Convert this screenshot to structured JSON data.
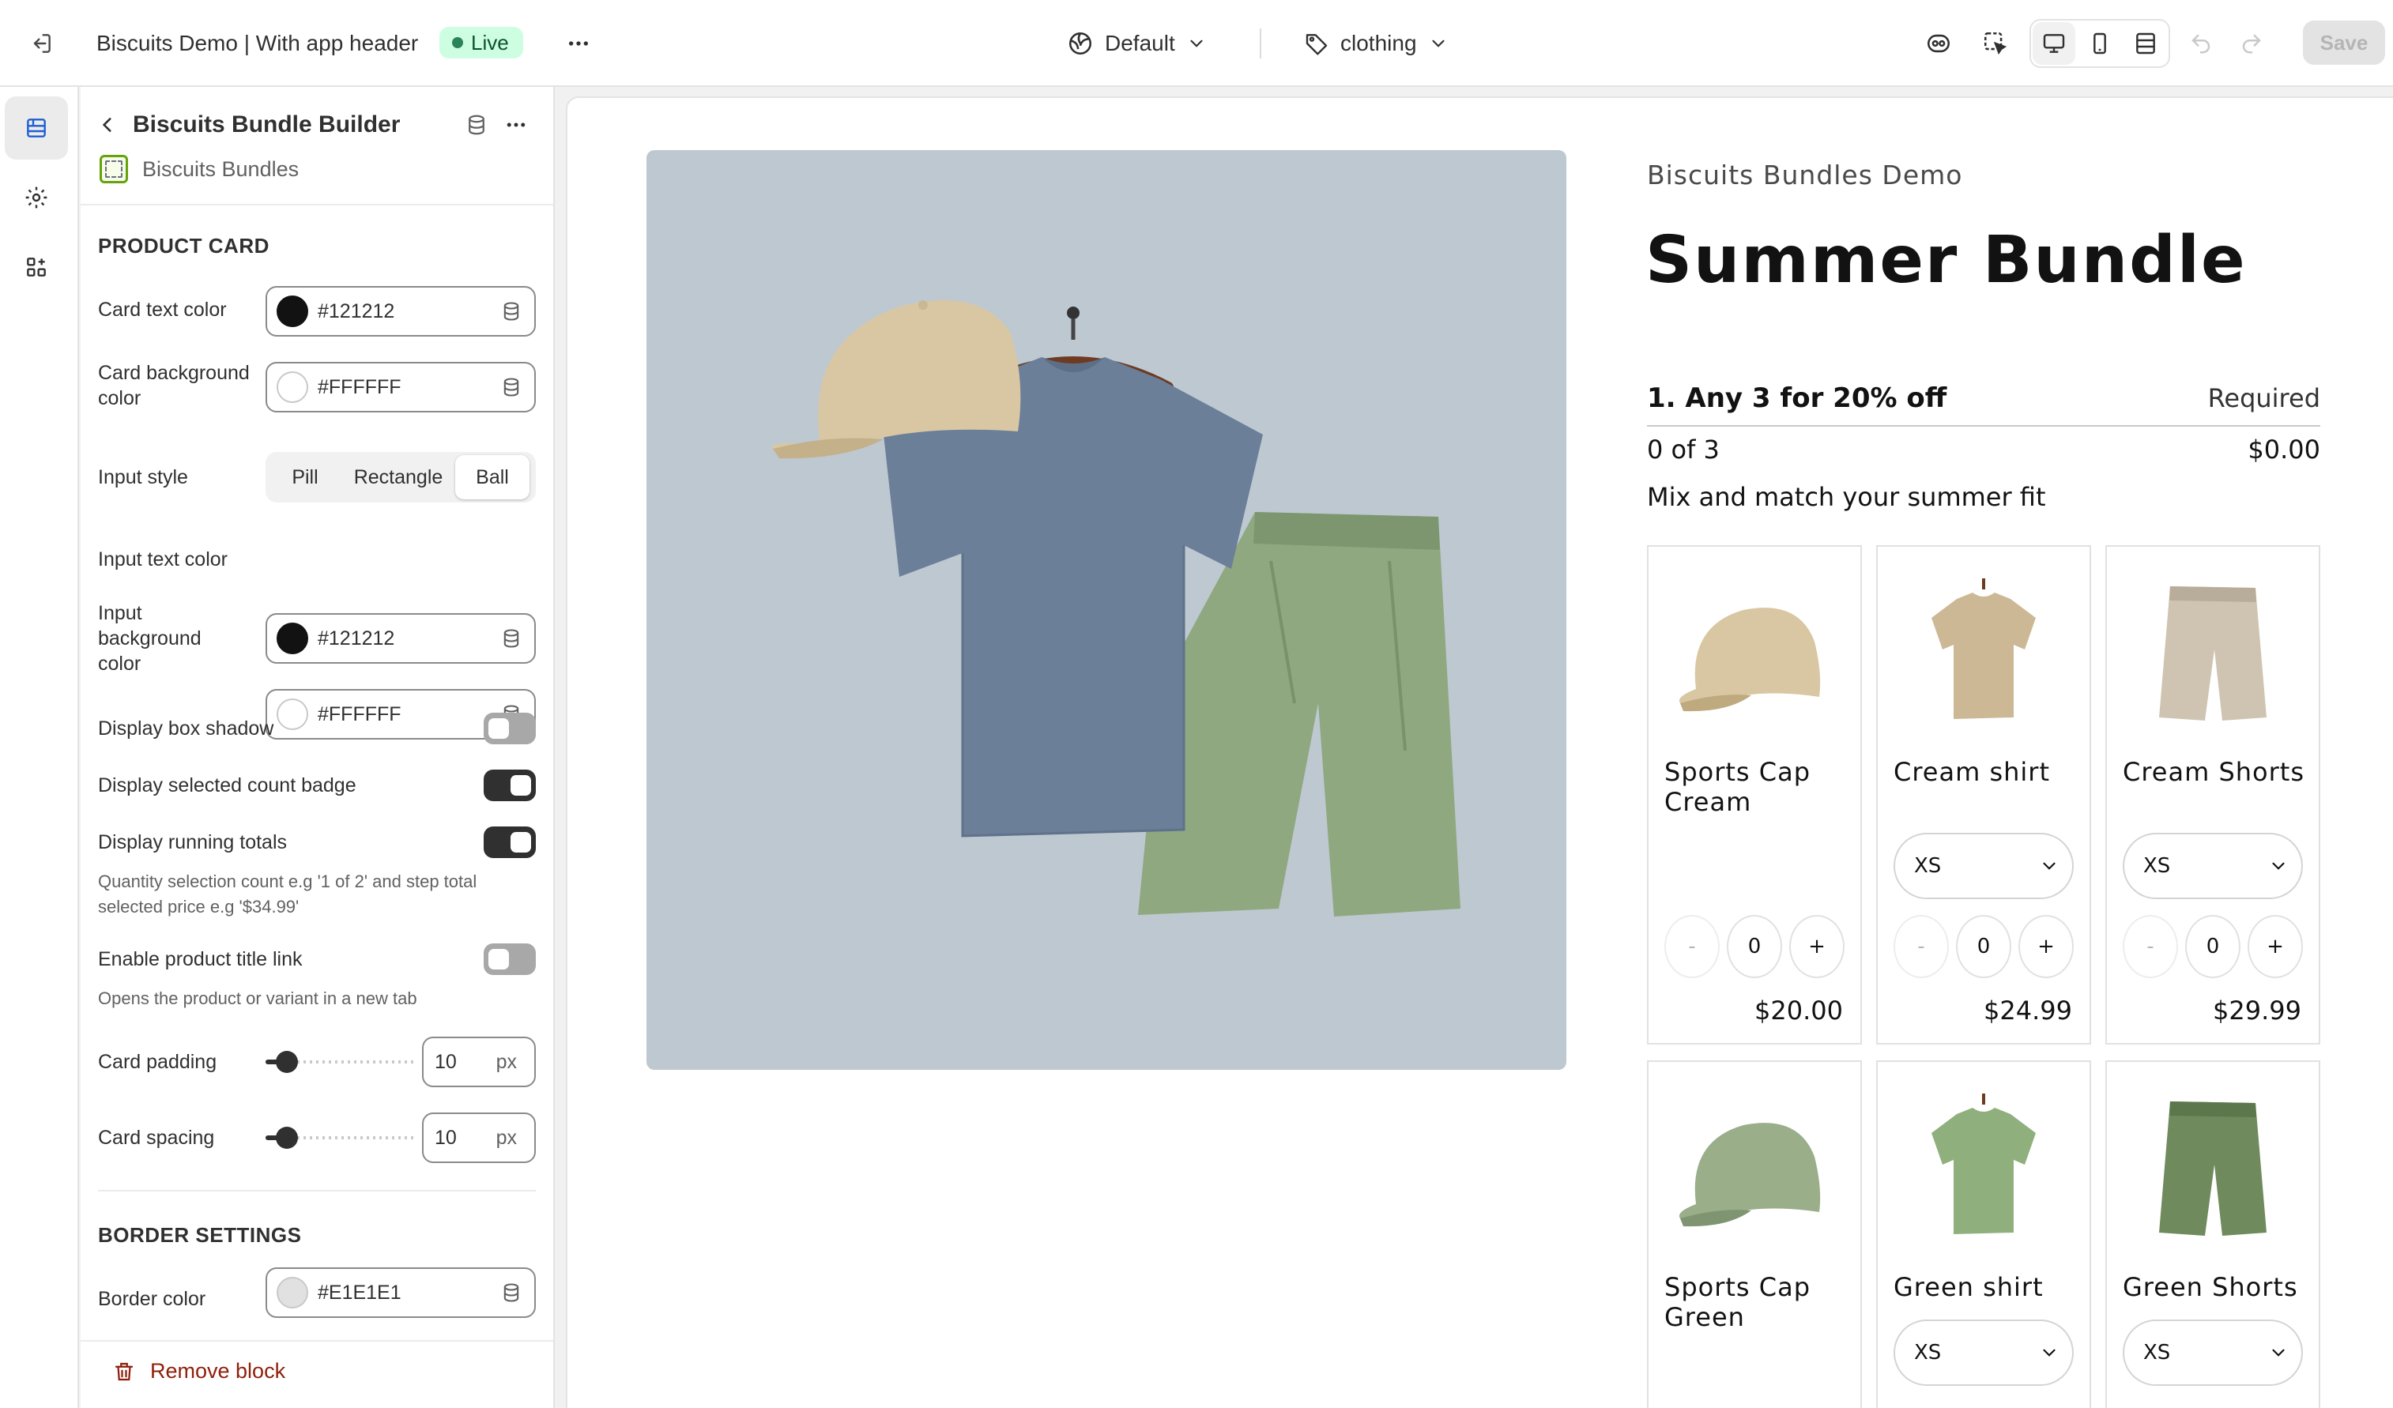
{
  "topbar": {
    "app_title": "Biscuits Demo | With app header",
    "status": "Live",
    "theme": "Default",
    "template": "clothing",
    "save_label": "Save",
    "colors": {
      "live_bg": "#cdfee1",
      "live_text": "#0c5132"
    }
  },
  "panel": {
    "title": "Biscuits Bundle Builder",
    "subtitle": "Biscuits Bundles",
    "product_card": {
      "section_title": "PRODUCT CARD",
      "card_text_color": {
        "label": "Card text color",
        "value": "#121212"
      },
      "card_bg_color": {
        "label": "Card background color",
        "value": "#FFFFFF"
      },
      "input_style": {
        "label": "Input style",
        "options": [
          "Pill",
          "Rectangle",
          "Ball"
        ],
        "selected": "Ball"
      },
      "input_text_color": {
        "label": "Input text color",
        "value": "#121212"
      },
      "input_bg_color": {
        "label": "Input background color",
        "value": "#FFFFFF"
      },
      "box_shadow": {
        "label": "Display box shadow",
        "on": false
      },
      "count_badge": {
        "label": "Display selected count badge",
        "on": true
      },
      "running_totals": {
        "label": "Display running totals",
        "on": true,
        "help": "Quantity selection count e.g '1 of 2' and step total selected price e.g '$34.99'"
      },
      "title_link": {
        "label": "Enable product title link",
        "on": false,
        "help": "Opens the product or variant in a new tab"
      },
      "card_padding": {
        "label": "Card padding",
        "value": "10",
        "unit": "px",
        "fraction": 0.08
      },
      "card_spacing": {
        "label": "Card spacing",
        "value": "10",
        "unit": "px",
        "fraction": 0.08
      }
    },
    "border_settings": {
      "section_title": "BORDER SETTINGS",
      "border_color": {
        "label": "Border color",
        "value": "#E1E1E1"
      }
    },
    "remove_label": "Remove block"
  },
  "preview": {
    "vendor": "Biscuits Bundles Demo",
    "product_title": "Summer Bundle",
    "step": {
      "title": "1.  Any 3 for 20% off",
      "required": "Required",
      "count": "0  of  3",
      "total": "$0.00",
      "description": "Mix and match your summer fit"
    },
    "cards": [
      {
        "name": "Sports Cap Cream",
        "price": "$20.00",
        "qty": "0",
        "image": "cap-cream"
      },
      {
        "name": "Cream shirt",
        "price": "$24.99",
        "qty": "0",
        "variant": "XS",
        "image": "shirt-cream"
      },
      {
        "name": "Cream Shorts",
        "price": "$29.99",
        "qty": "0",
        "variant": "XS",
        "image": "shorts-cream"
      },
      {
        "name": "Sports Cap Green",
        "image": "cap-green"
      },
      {
        "name": "Green shirt",
        "variant": "XS",
        "image": "shirt-green"
      },
      {
        "name": "Green Shorts",
        "variant": "XS",
        "image": "shorts-green"
      }
    ],
    "colors": {
      "cream": "#d9c7a3",
      "green": "#8fa880",
      "navy_shirt": "#6b7f99"
    }
  }
}
